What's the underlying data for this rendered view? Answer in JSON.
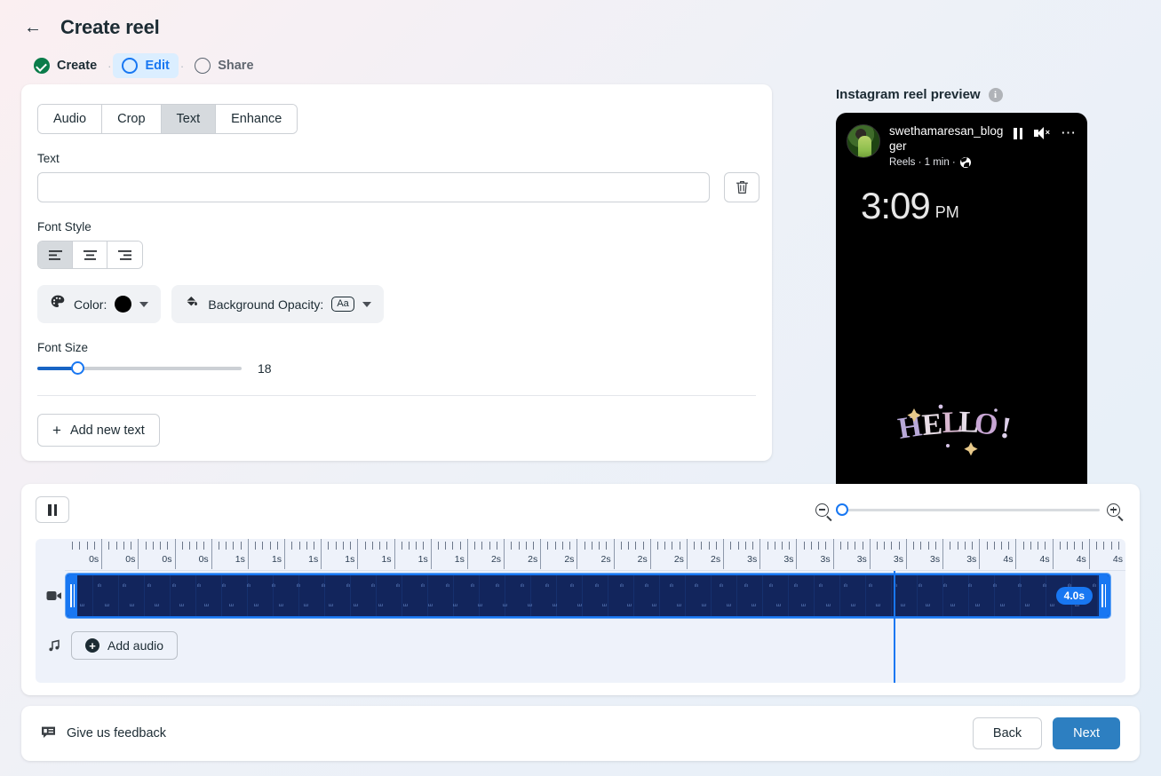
{
  "header": {
    "back_icon": "arrow-left-icon",
    "title": "Create reel",
    "steps": [
      {
        "label": "Create",
        "state": "done"
      },
      {
        "label": "Edit",
        "state": "active"
      },
      {
        "label": "Share",
        "state": "todo"
      }
    ],
    "separator": "·"
  },
  "editor": {
    "tabs": [
      {
        "label": "Audio",
        "selected": false
      },
      {
        "label": "Crop",
        "selected": false
      },
      {
        "label": "Text",
        "selected": true
      },
      {
        "label": "Enhance",
        "selected": false
      }
    ],
    "text_label": "Text",
    "text_value": "",
    "text_placeholder": "",
    "delete_icon": "trash-icon",
    "font_style_label": "Font Style",
    "align_options": [
      {
        "name": "align-left",
        "selected": true
      },
      {
        "name": "align-center",
        "selected": false
      },
      {
        "name": "align-right",
        "selected": false
      }
    ],
    "color_label": "Color:",
    "color_value": "#000000",
    "background_opacity_label": "Background Opacity:",
    "background_opacity_value": "Aa",
    "font_size_label": "Font Size",
    "font_size_value": "18",
    "add_new_text_label": "Add new text"
  },
  "preview": {
    "title": "Instagram reel preview",
    "info_icon": "info-icon",
    "username": "swethamaresan_blogger",
    "subtitle": "Reels · 1 min ·",
    "audience_icon": "globe-icon",
    "pause_icon": "pause-icon",
    "mute_icon": "volume-mute-icon",
    "more_icon": "more-options-icon",
    "clock_time": "3:09",
    "clock_ampm": "PM",
    "sticker_text": "HELLO!"
  },
  "timeline": {
    "play_icon": "pause-icon",
    "zoom_out_icon": "zoom-out-icon",
    "zoom_in_icon": "zoom-in-icon",
    "zoom_value": 0,
    "ruler_labels": [
      "0s",
      "0s",
      "0s",
      "0s",
      "1s",
      "1s",
      "1s",
      "1s",
      "1s",
      "1s",
      "1s",
      "2s",
      "2s",
      "2s",
      "2s",
      "2s",
      "2s",
      "2s",
      "3s",
      "3s",
      "3s",
      "3s",
      "3s",
      "3s",
      "3s",
      "4s",
      "4s",
      "4s",
      "4s"
    ],
    "video_track_icon": "video-camera-icon",
    "clip_duration_badge": "4.0s",
    "audio_track_icon": "music-note-icon",
    "add_audio_label": "Add audio"
  },
  "footer": {
    "feedback_icon": "feedback-icon",
    "feedback_label": "Give us feedback",
    "back_label": "Back",
    "next_label": "Next"
  },
  "colors": {
    "accent_blue": "#1877f2",
    "primary_button": "#2d7fc1",
    "done_green": "#0a7c4a",
    "clip_navy": "#12255c"
  }
}
